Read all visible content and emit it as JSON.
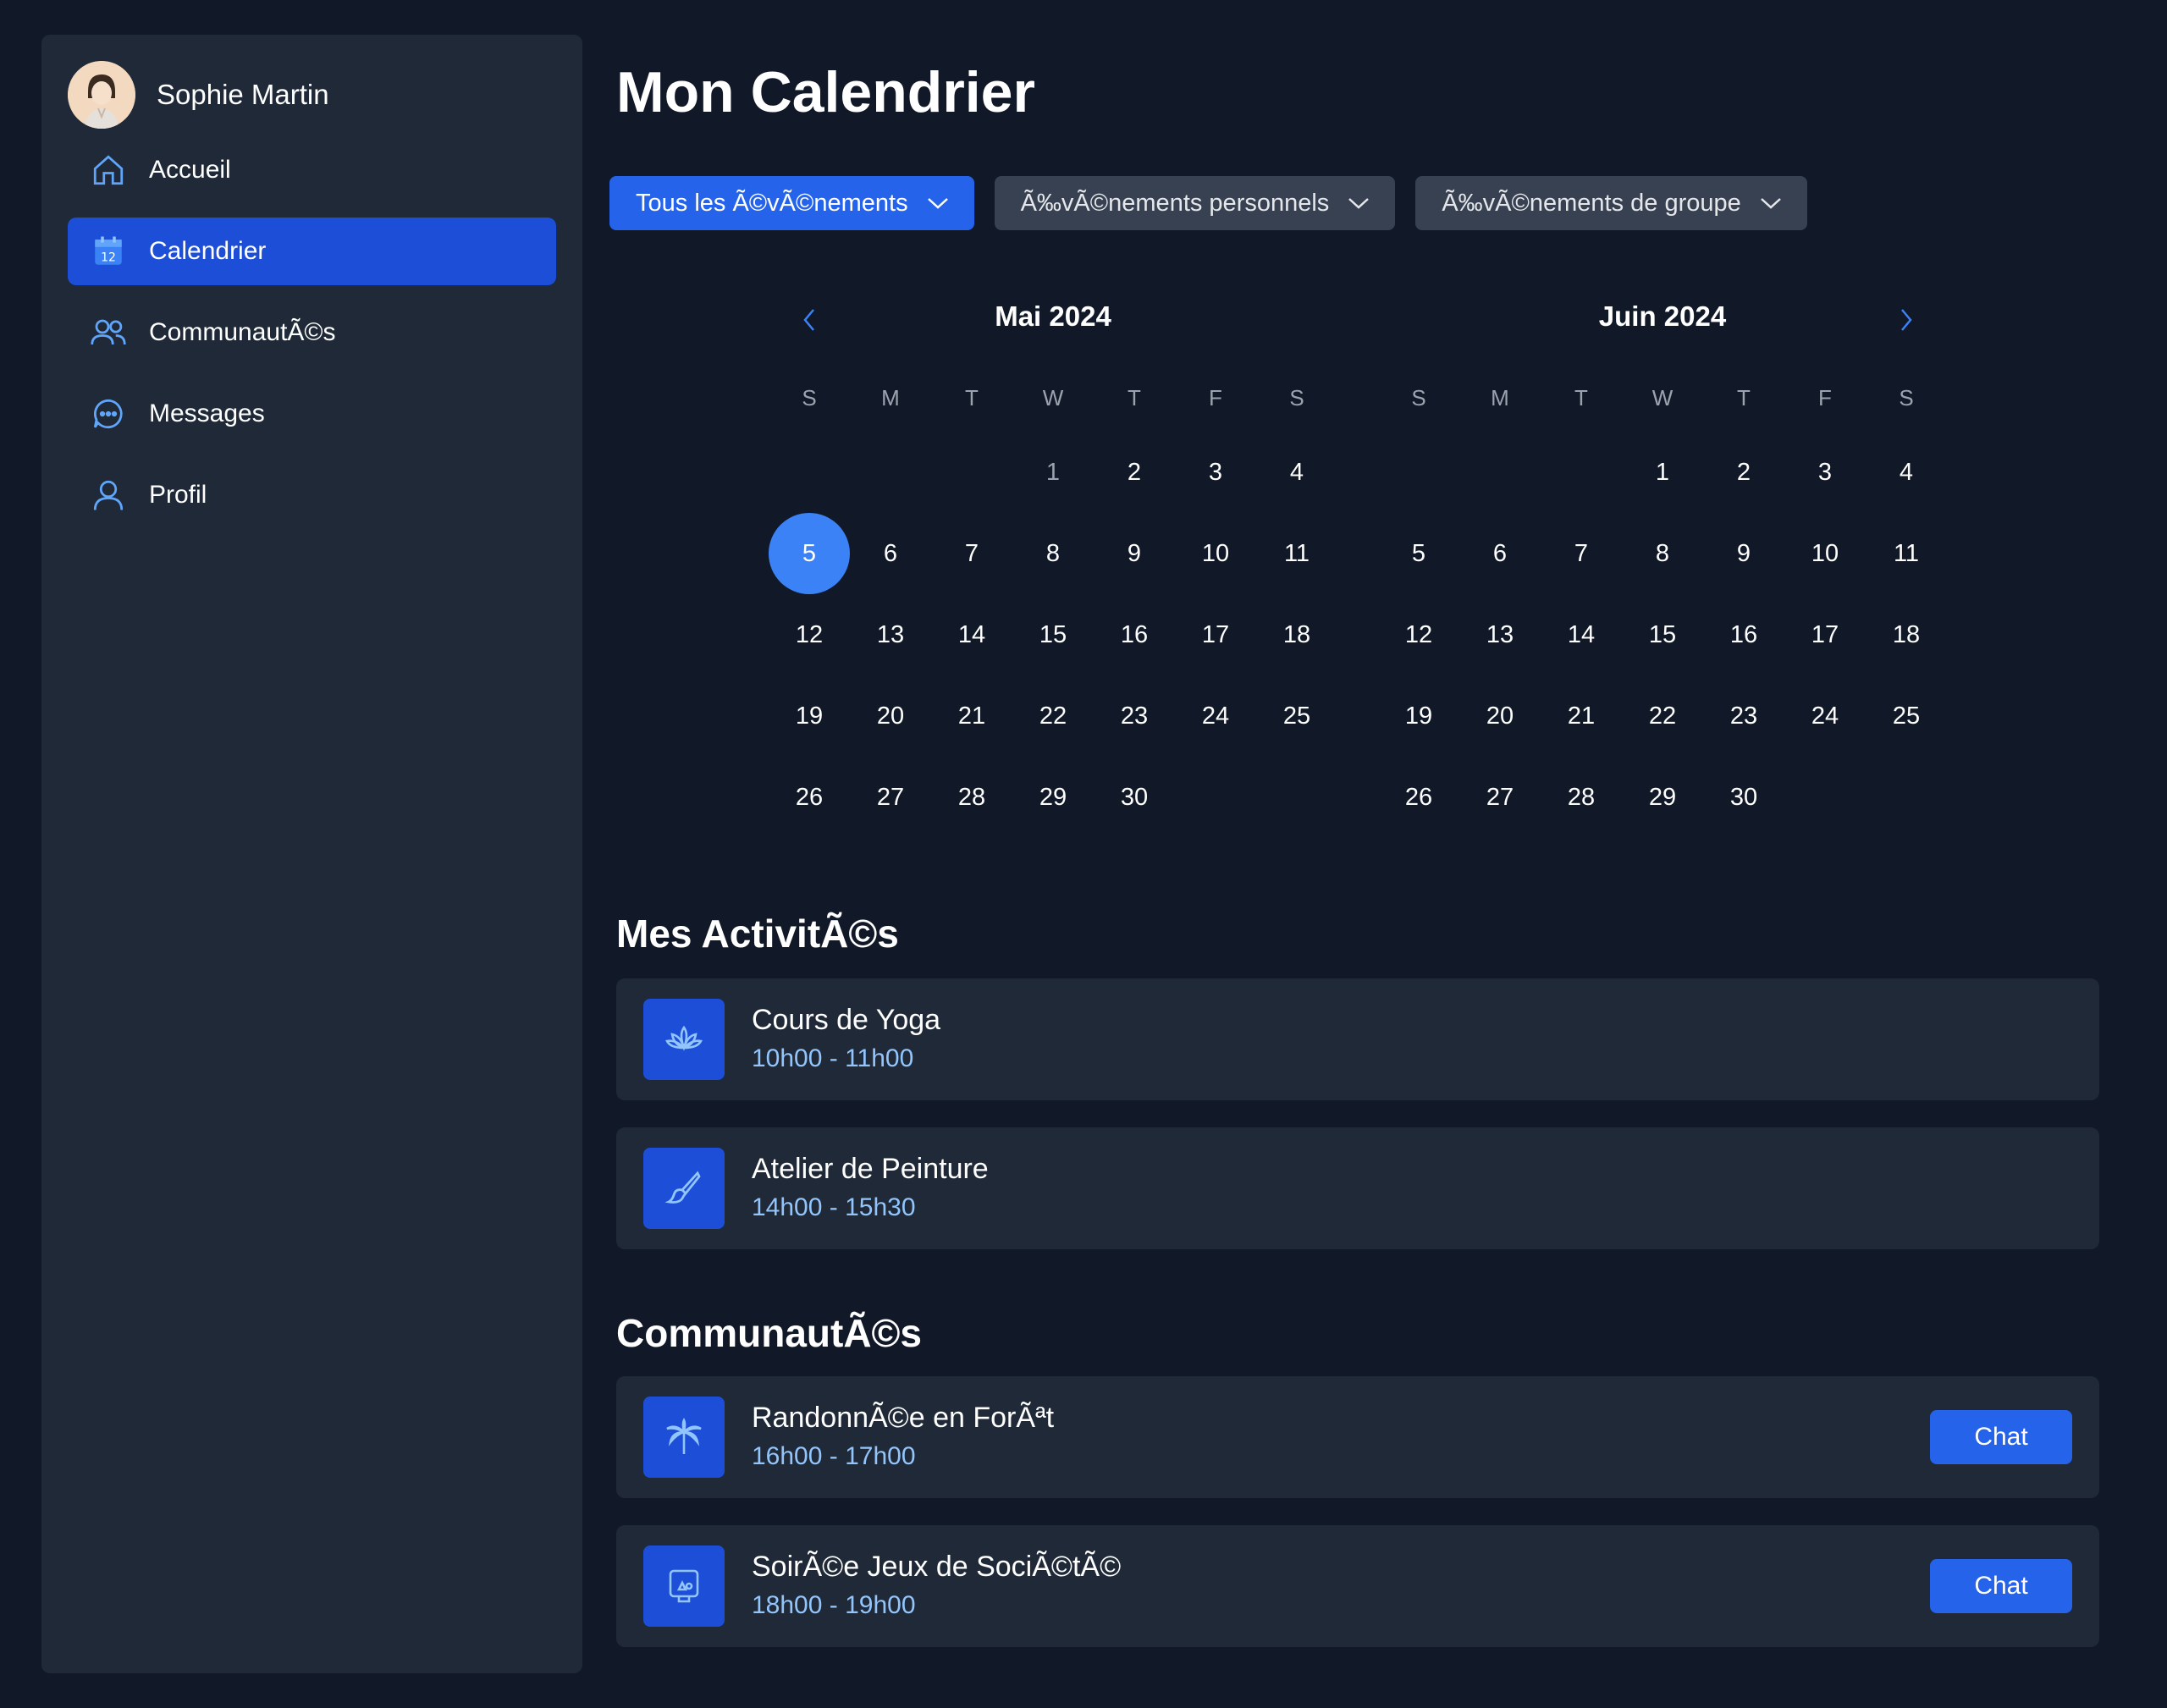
{
  "user": {
    "name": "Sophie Martin"
  },
  "sidebar": {
    "items": [
      {
        "label": "Accueil",
        "icon": "home-icon",
        "active": false
      },
      {
        "label": "Calendrier",
        "icon": "calendar-icon",
        "active": true
      },
      {
        "label": "CommunautÃ©s",
        "icon": "users-icon",
        "active": false
      },
      {
        "label": "Messages",
        "icon": "chat-bubble-icon",
        "active": false
      },
      {
        "label": "Profil",
        "icon": "user-icon",
        "active": false
      }
    ]
  },
  "page": {
    "title": "Mon Calendrier"
  },
  "filters": [
    {
      "label": "Tous les Ã©vÃ©nements",
      "active": true
    },
    {
      "label": "Ã‰vÃ©nements personnels",
      "active": false
    },
    {
      "label": "Ã‰vÃ©nements de groupe",
      "active": false
    }
  ],
  "calendar": {
    "weekdays": [
      "S",
      "M",
      "T",
      "W",
      "T",
      "F",
      "S"
    ],
    "months": [
      {
        "title": "Mai 2024",
        "first_weekday": 3,
        "days": 30,
        "selected_day": 5,
        "muted_days": [
          1
        ]
      },
      {
        "title": "Juin 2024",
        "first_weekday": 3,
        "days": 30,
        "selected_day": null,
        "muted_days": []
      }
    ]
  },
  "activities": {
    "title": "Mes ActivitÃ©s",
    "items": [
      {
        "title": "Cours de Yoga",
        "time": "10h00 - 11h00",
        "icon": "lotus-icon"
      },
      {
        "title": "Atelier de Peinture",
        "time": "14h00 - 15h30",
        "icon": "paintbrush-icon"
      }
    ]
  },
  "communities": {
    "title": "CommunautÃ©s",
    "chat_label": "Chat",
    "items": [
      {
        "title": "RandonnÃ©e en ForÃªt",
        "time": "16h00 - 17h00",
        "icon": "palm-tree-icon"
      },
      {
        "title": "SoirÃ©e Jeux de SociÃ©tÃ©",
        "time": "18h00 - 19h00",
        "icon": "board-game-icon"
      }
    ]
  },
  "colors": {
    "accent": "#2563eb",
    "active_nav": "#1d4ed8",
    "selected_day": "#3b82f6",
    "time_text": "#93c5fd"
  }
}
